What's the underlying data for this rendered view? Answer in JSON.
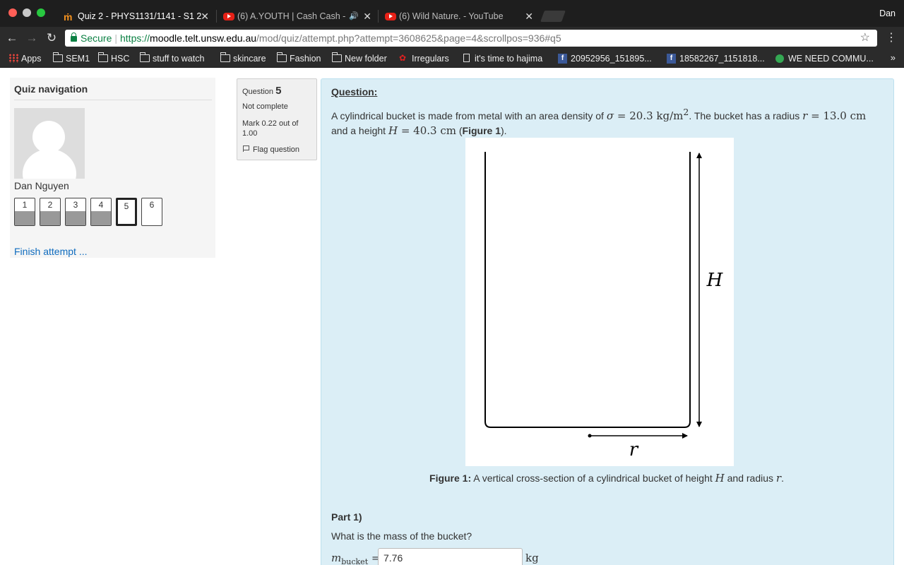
{
  "browser": {
    "tabs": [
      {
        "title": "Quiz 2 - PHYS1131/1141 - S1 2",
        "icon": "moodle-icon",
        "active": true
      },
      {
        "title": "(6) A.YOUTH | Cash Cash -",
        "icon": "youtube-icon",
        "audio": true
      },
      {
        "title": "(6) Wild Nature. - YouTube",
        "icon": "youtube-icon"
      }
    ],
    "close_glyph": "✕",
    "audio_glyph": "🔊",
    "profile": "Dan",
    "secure_label": "Secure",
    "url_scheme": "https://",
    "url_host": "moodle.telt.unsw.edu.au",
    "url_path": "/mod/quiz/attempt.php?attempt=3608625&page=4&scrollpos=936#q5",
    "bookmarks": [
      {
        "label": "Apps",
        "icon": "apps-grid-icon"
      },
      {
        "label": "SEM1",
        "icon": "folder-icon"
      },
      {
        "label": "HSC",
        "icon": "folder-icon"
      },
      {
        "label": "stuff to watch",
        "icon": "folder-icon"
      },
      {
        "label": "skincare",
        "icon": "folder-icon"
      },
      {
        "label": "Fashion",
        "icon": "folder-icon"
      },
      {
        "label": "New folder",
        "icon": "folder-icon"
      },
      {
        "label": "Irregulars",
        "icon": "irregulars-icon"
      },
      {
        "label": "it's time to hajima",
        "icon": "document-icon"
      },
      {
        "label": "20952956_151895...",
        "icon": "facebook-icon"
      },
      {
        "label": "18582267_1151818...",
        "icon": "facebook-icon"
      },
      {
        "label": "WE NEED COMMU...",
        "icon": "green-dot-icon"
      }
    ],
    "more_glyph": "»"
  },
  "quiz_nav": {
    "title": "Quiz navigation",
    "user": "Dan Nguyen",
    "questions": [
      {
        "label": "1",
        "answered": true
      },
      {
        "label": "2",
        "answered": true
      },
      {
        "label": "3",
        "answered": true
      },
      {
        "label": "4",
        "answered": true
      },
      {
        "label": "5",
        "answered": false,
        "current": true
      },
      {
        "label": "6",
        "answered": false
      }
    ],
    "finish_label": "Finish attempt ..."
  },
  "question_info": {
    "prefix": "Question",
    "number": "5",
    "state": "Not complete",
    "mark": "Mark 0.22 out of 1.00",
    "flag_label": "Flag question"
  },
  "question": {
    "title": "Question:",
    "intro_1": "A cylindrical bucket is made from metal with an area density of",
    "sigma_sym": "σ",
    "sigma_value": "= 20.3 kg/m",
    "sigma_exp": "2",
    "intro_2": ". The bucket has a radius",
    "r_sym": "r",
    "r_value": "= 13.0 cm",
    "intro_3": "and a height",
    "h_sym": "H",
    "h_value": "= 40.3 cm",
    "intro_4": "(",
    "figure_ref": "Figure 1",
    "intro_5": ").",
    "figure_labels": {
      "height": "H",
      "radius": "r"
    },
    "caption_bold": "Figure 1:",
    "caption_text_1": "A vertical cross-section of a cylindrical bucket of height",
    "caption_text_2": "and radius",
    "caption_text_3": ".",
    "part_label": "Part 1)",
    "prompt": "What is the mass of the bucket?",
    "answer_symbol": "m",
    "answer_subscript": "bucket",
    "answer_eq": "=",
    "answer_value": "7.76",
    "answer_unit": "kg"
  },
  "colors": {
    "question_bg": "#dbeef6",
    "link": "#0f6cbf",
    "secure_green": "#0b8043"
  }
}
